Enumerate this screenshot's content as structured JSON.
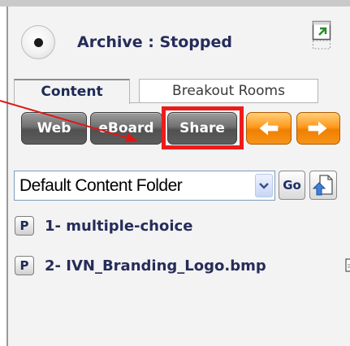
{
  "archive": {
    "status_label": "Archive : Stopped"
  },
  "tabs": [
    {
      "label": "Content",
      "active": true
    },
    {
      "label": "Breakout Rooms",
      "active": false
    }
  ],
  "toolbar": {
    "web_label": "Web",
    "eboard_label": "eBoard",
    "share_label": "Share",
    "back_icon": "arrow-left-icon",
    "forward_icon": "arrow-right-icon"
  },
  "folder": {
    "selected": "Default Content Folder",
    "go_label": "Go"
  },
  "content_items": [
    {
      "badge": "P",
      "label": "1- multiple-choice"
    },
    {
      "badge": "P",
      "label": "2- IVN_Branding_Logo.bmp"
    }
  ],
  "colors": {
    "highlight": "#ee1b1b",
    "orange_button": "#f79418",
    "text_dark_blue": "#262c5a"
  }
}
